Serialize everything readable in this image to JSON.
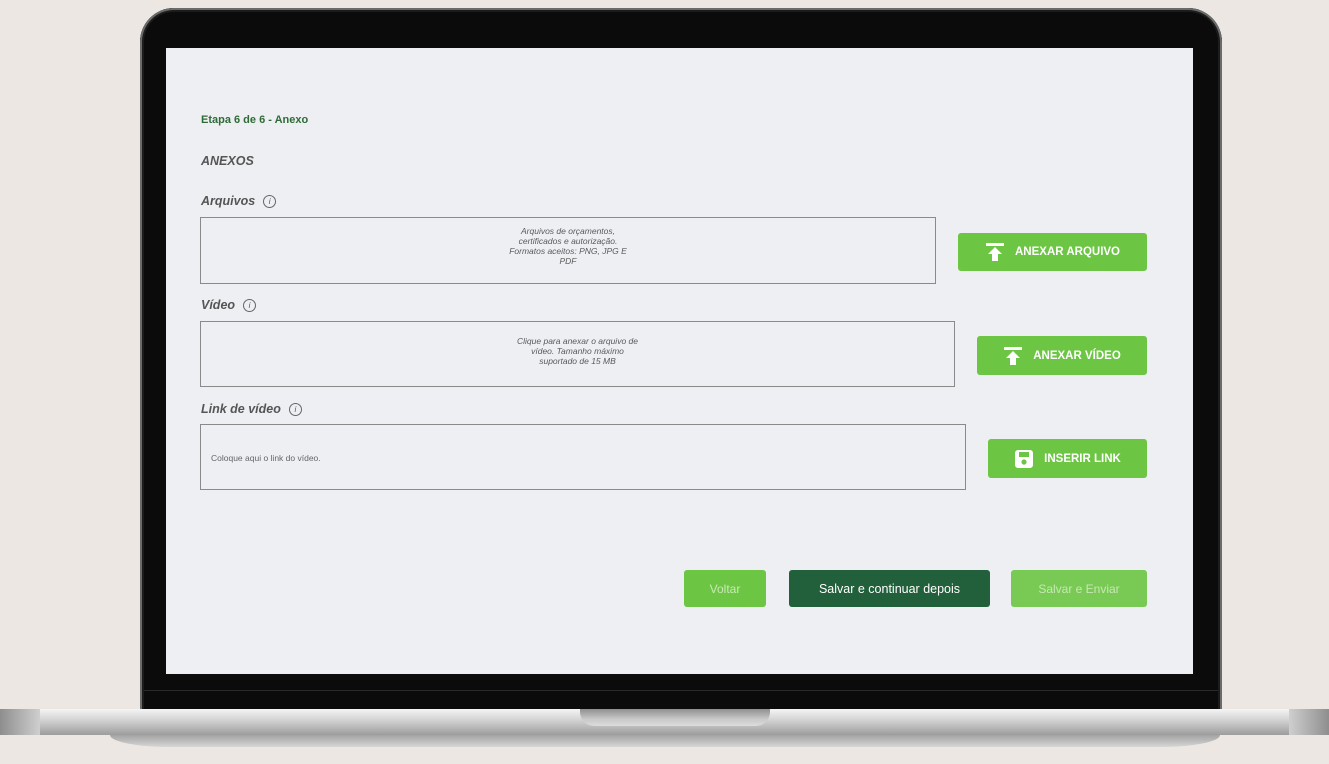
{
  "form": {
    "step": "Etapa 6 de 6 - Anexo",
    "section_title": "ANEXOS",
    "info_glyph": "i",
    "arquivos": {
      "label": "Arquivos",
      "hint_lines": [
        "Arquivos de orçamentos,",
        "certificados e autorização.",
        "Formatos aceitos: PNG, JPG E",
        "PDF"
      ],
      "button_label": "ANEXAR ARQUIVO",
      "button_icon": "upload-icon"
    },
    "video": {
      "label": "Vídeo",
      "hint_lines": [
        "Clique para anexar o arquivo de",
        "vídeo. Tamanho máximo",
        "suportado de 15 MB"
      ],
      "button_label": "ANEXAR VÍDEO",
      "button_icon": "upload-icon"
    },
    "link": {
      "label": "Link de vídeo",
      "placeholder": "Coloque aqui o link do vídeo.",
      "value": "",
      "button_label": "INSERIR LINK",
      "button_icon": "save-icon"
    }
  },
  "actions": {
    "back_label": "Voltar",
    "save_later_label": "Salvar e continuar depois",
    "save_send_label": "Salvar e Enviar"
  },
  "colors": {
    "accent_green": "#6cc543",
    "dark_green": "#21603a",
    "step_text": "#2f6b37",
    "screen_bg": "#eeeff3"
  }
}
